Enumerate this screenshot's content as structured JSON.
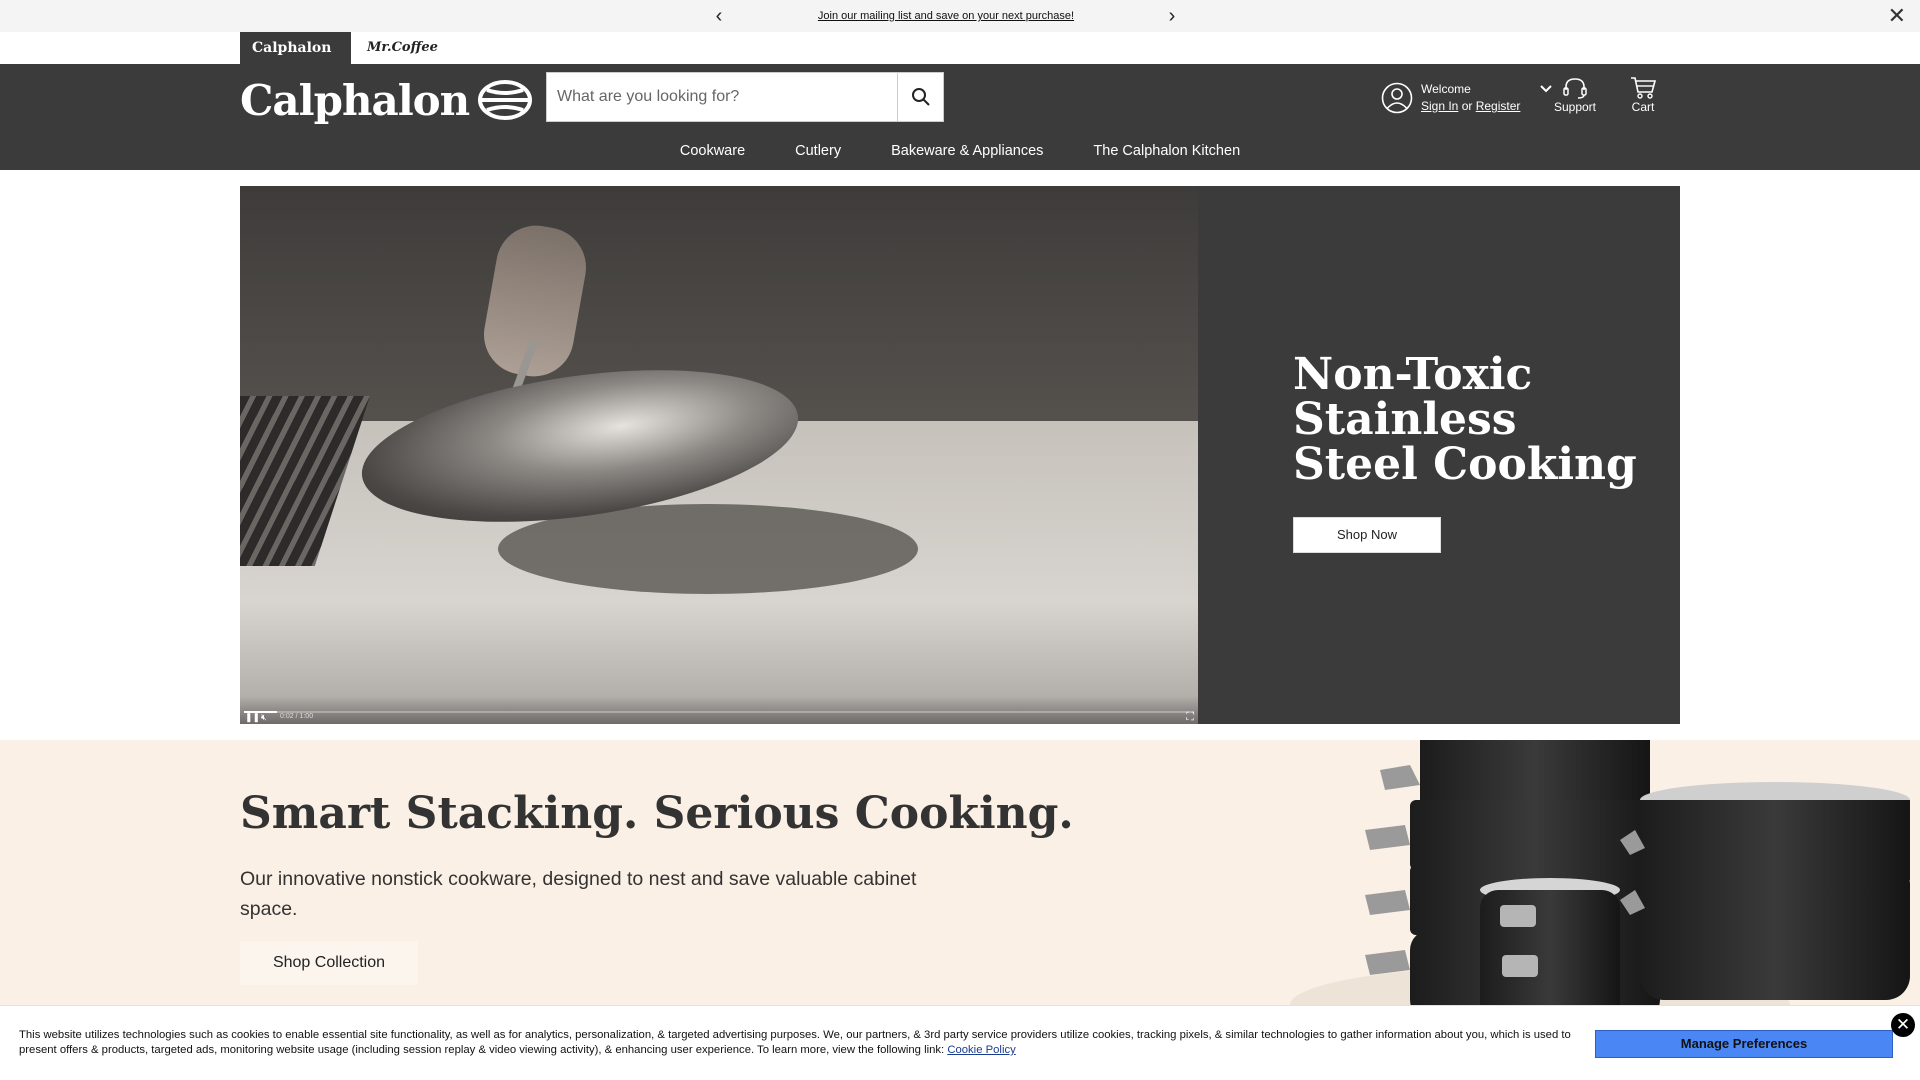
{
  "promo": {
    "message": "Join our mailing list and save on your next purchase!",
    "prev_icon": "chevron-left-icon",
    "next_icon": "chevron-right-icon",
    "close_icon": "close-icon"
  },
  "brand_tabs": {
    "calphalon": "Calphalon",
    "mrcoffee": "Mr.Coffee"
  },
  "header": {
    "logo": "Calphalon",
    "search_placeholder": "What are you looking for?",
    "welcome": "Welcome",
    "sign_in": "Sign In",
    "or": "or",
    "register": "Register",
    "support": "Support",
    "cart": "Cart"
  },
  "nav": [
    "Cookware",
    "Cutlery",
    "Bakeware & Appliances",
    "The Calphalon Kitchen"
  ],
  "hero": {
    "title": "Non-Toxic Stainless Steel Cooking",
    "button": "Shop Now",
    "video_time": "0:02 / 1:00",
    "video_progress": 0.035
  },
  "stacking": {
    "title": "Smart Stacking. Serious Cooking.",
    "description": "Our innovative nonstick cookware, designed to nest and save valuable cabinet space.",
    "button": "Shop Collection"
  },
  "cookie": {
    "text": "This website utilizes technologies such as cookies to enable essential site functionality, as well as for analytics, personalization, & targeted advertising purposes. We, our partners, & 3rd party service providers utilize cookies, tracking pixels, & similar technologies to gather information about you, which is used to present offers & products, targeted ads, monitoring website usage (including session replay & video viewing activity), & enhancing user experience. To learn more, view the following link:",
    "link": "Cookie Policy",
    "button": "Manage Preferences"
  },
  "colors": {
    "header_bg": "#3b3b3b",
    "section_bg": "#faf0e6",
    "cookie_button": "#4a87f5"
  }
}
